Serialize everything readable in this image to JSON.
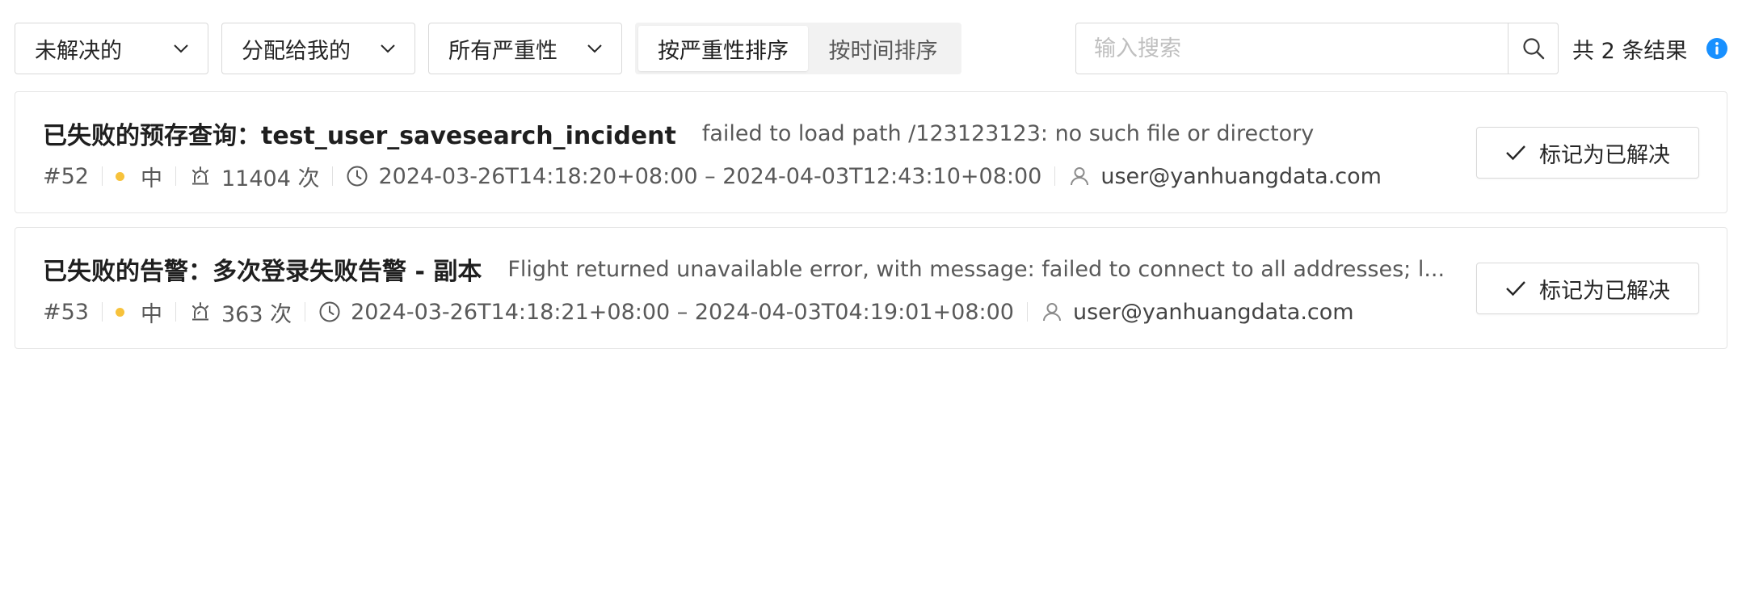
{
  "filters": {
    "status": {
      "selected": "未解决的",
      "icon": "chevron-down-icon"
    },
    "assignee": {
      "selected": "分配给我的",
      "icon": "chevron-down-icon"
    },
    "severity": {
      "selected": "所有严重性",
      "icon": "chevron-down-icon"
    }
  },
  "sort": {
    "options": [
      {
        "label": "按严重性排序",
        "active": true
      },
      {
        "label": "按时间排序",
        "active": false
      }
    ]
  },
  "search": {
    "value": "",
    "placeholder": "输入搜索",
    "icon": "search-icon"
  },
  "result_count": "共 2 条结果",
  "colors": {
    "severity_medium": "#f7c23b",
    "info_icon": "#1890ff",
    "border": "#d9d9d9"
  },
  "incidents": [
    {
      "title": "已失败的预存查询：test_user_savesearch_incident",
      "description": "failed to load path /123123123: no such file or directory",
      "id": "#52",
      "severity": "中",
      "count": "11404 次",
      "time_range": "2024-03-26T14:18:20+08:00 – 2024-04-03T12:43:10+08:00",
      "assignee": "user@yanhuangdata.com",
      "action_label": "标记为已解决"
    },
    {
      "title": "已失败的告警：多次登录失败告警 - 副本",
      "description": "Flight returned unavailable error, with message: failed to connect to all addresses; l...",
      "id": "#53",
      "severity": "中",
      "count": "363 次",
      "time_range": "2024-03-26T14:18:21+08:00 – 2024-04-03T04:19:01+08:00",
      "assignee": "user@yanhuangdata.com",
      "action_label": "标记为已解决"
    }
  ]
}
